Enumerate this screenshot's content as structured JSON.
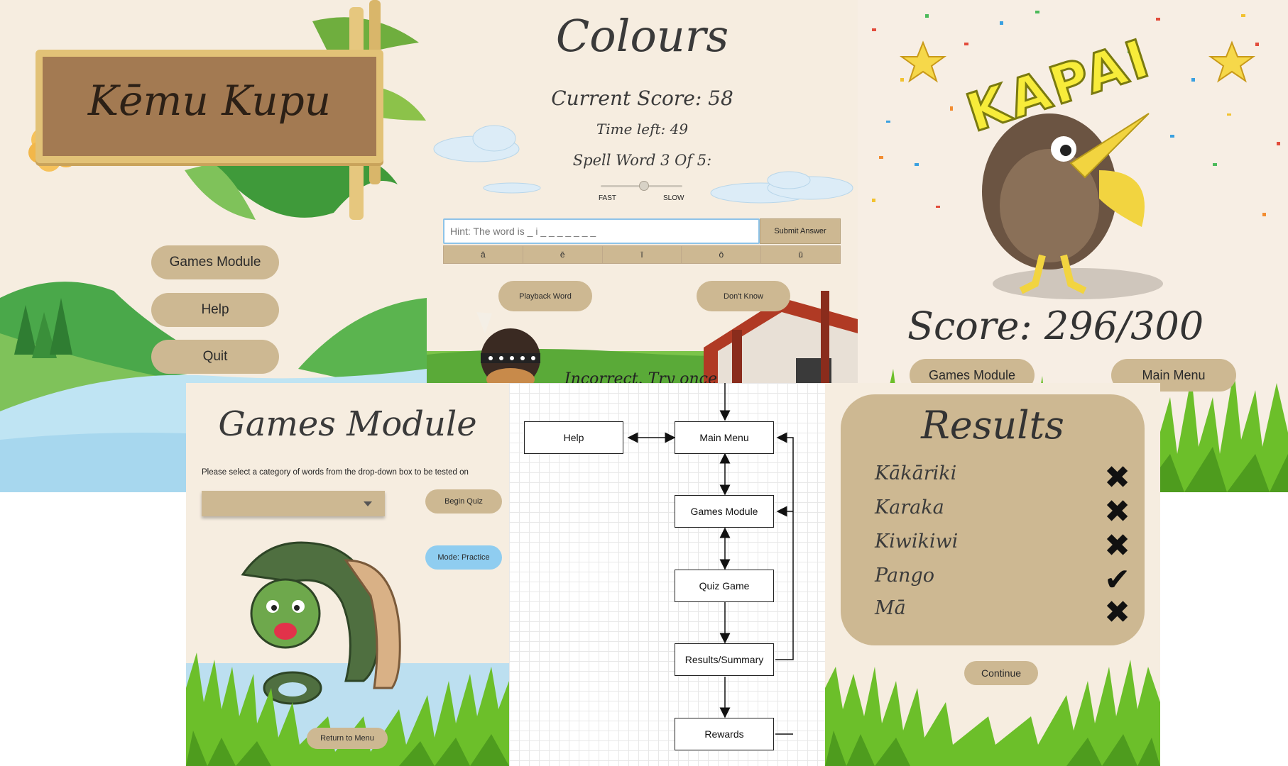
{
  "main_menu": {
    "title": "Kēmu Kupu",
    "buttons": [
      "Games Module",
      "Help",
      "Quit"
    ]
  },
  "quiz": {
    "title": "Colours",
    "score_text": "Current Score: 58",
    "time_text": "Time left: 49",
    "progress_text": "Spell Word 3 Of 5:",
    "speed_fast": "FAST",
    "speed_slow": "SLOW",
    "answer_placeholder": "Hint: The word is _ i _ _ _ _ _ _ _",
    "submit_label": "Submit Answer",
    "macron_keys": [
      "ā",
      "ē",
      "ī",
      "ō",
      "ū"
    ],
    "playback_label": "Playback Word",
    "dont_know_label": "Don't Know",
    "feedback_text": "Incorrect. Try once"
  },
  "rewards": {
    "banner": "KAPAI",
    "score_text": "Score: 296/300",
    "buttons": [
      "Games Module",
      "Main Menu"
    ]
  },
  "games_module": {
    "title": "Games Module",
    "instructions": "Please select a category of words from the drop-down box to be tested on",
    "select_value": "",
    "begin_label": "Begin Quiz",
    "mode_label": "Mode: Practice",
    "return_label": "Return to Menu"
  },
  "flow": {
    "nodes": [
      "Help",
      "Main Menu",
      "Games Module",
      "Quiz Game",
      "Results/Summary",
      "Rewards"
    ]
  },
  "results": {
    "title": "Results",
    "items": [
      {
        "word": "Kākāriki",
        "correct": false
      },
      {
        "word": "Karaka",
        "correct": false
      },
      {
        "word": "Kiwikiwi",
        "correct": false
      },
      {
        "word": "Pango",
        "correct": true
      },
      {
        "word": "Mā",
        "correct": false
      }
    ],
    "wrong_mark": "✖",
    "right_mark": "✔",
    "continue_label": "Continue"
  },
  "colors": {
    "background": "#f6ede0",
    "button": "#cdb892",
    "sign_wood": "#a37a52",
    "mode_button": "#8fcdf0",
    "grass": "#6cbf2a"
  }
}
